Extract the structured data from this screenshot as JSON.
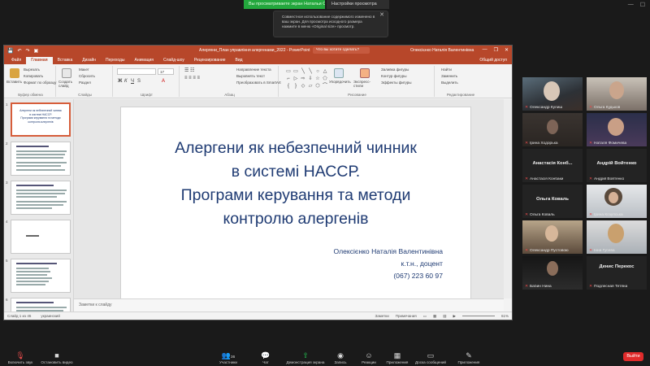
{
  "zoom": {
    "share_badge": "Вы просматриваете экран Натальи Олексиенко",
    "view_options": "Настройки просмотра",
    "toast_text": "Совместное использование содержимого изменено в ваш экран. Для просмотра исходного размера нажмите в меню «Original size» просмотр.",
    "toast_close": "✕",
    "toolbar": {
      "mute": "Включить звук",
      "video": "Остановить видео",
      "participants": "Участники",
      "participants_count": "36",
      "chat": "Чат",
      "share": "Демонстрация экрана",
      "record": "Запись",
      "reactions": "Реакции",
      "apps": "Приложения",
      "whiteboards": "Доска сообщений",
      "notes": "Приложения",
      "leave": "Выйти"
    },
    "participants": [
      {
        "name": "Олександр Кулиш",
        "kind": "video",
        "muted": true
      },
      {
        "name": "Ольга Кудьков",
        "kind": "video",
        "muted": true
      },
      {
        "name": "Ірина Ходорька",
        "kind": "video",
        "muted": true
      },
      {
        "name": "Наталя Фомичева",
        "kind": "video",
        "muted": true
      },
      {
        "name": "Анастасія Конбаки",
        "kind": "name",
        "display": "Анастасія Конб...",
        "muted": true
      },
      {
        "name": "Андрій Войтенко",
        "kind": "name",
        "display": "Андрій Войтенко",
        "muted": true
      },
      {
        "name": "Ольга Коваль",
        "kind": "name",
        "display": "Ольга Коваль",
        "muted": true
      },
      {
        "name": "Ірина Козупська",
        "kind": "video",
        "muted": true,
        "active": true
      },
      {
        "name": "Олександр Пустовою",
        "kind": "video",
        "muted": true
      },
      {
        "name": "Інна Гусева",
        "kind": "video",
        "muted": true
      },
      {
        "name": "Бабин Нина",
        "kind": "video",
        "muted": true
      },
      {
        "name": "Подлесная Тетяна",
        "kind": "name",
        "display": "Денис Перекос",
        "muted": true
      }
    ]
  },
  "ppt": {
    "doc_title": "Алергени_План управління алергенами_2022 - PowerPoint",
    "search_placeholder": "Что вы хотите сделать?",
    "user": "Олексієнко Наталія Валентинівна",
    "share_btn": "Общий доступ",
    "tabs": [
      "Файл",
      "Главная",
      "Вставка",
      "Дизайн",
      "Переходы",
      "Анимация",
      "Слайд-шоу",
      "Рецензирование",
      "Вид"
    ],
    "active_tab": "Главная",
    "ribbon": {
      "paste": "Вставить",
      "cut": "Вырезать",
      "copy": "Копировать",
      "format_painter": "Формат по образцу",
      "clipboard": "Буфер обмена",
      "new_slide": "Создать слайд",
      "layout": "Макет",
      "reset": "Сбросить",
      "section": "Раздел",
      "slides": "Слайды",
      "font": "Шрифт",
      "paragraph": "Абзац",
      "text_direction": "Направление текста",
      "align_text": "Выровнять текст",
      "smartart": "Преобразовать в SmartArt",
      "drawing": "Рисование",
      "arrange": "Упорядочить",
      "quick_styles": "Экспресс-стили",
      "fill": "Заливка фигуры",
      "outline": "Контур фигуры",
      "effects": "Эффекты фигуры",
      "find": "Найти",
      "replace": "Заменить",
      "select": "Выделить",
      "editing": "Редактирование",
      "font_size": "17"
    },
    "slide": {
      "title_lines": [
        "Алергени як небезпечний чинник",
        "в системі НАССР.",
        "Програми керування та методи",
        "контролю алергенів"
      ],
      "author": "Олексієнко Наталія Валентинівна",
      "degree": "к.т.н., доцент",
      "phone": "(067) 223 60 97"
    },
    "notes_placeholder": "Заметки к слайду",
    "status": {
      "slide_counter": "Слайд 1 из 45",
      "language": "украинский",
      "notes": "Заметки",
      "comments": "Примечания",
      "zoom": "61%"
    },
    "thumb_numbers": [
      "1",
      "2",
      "3",
      "4",
      "5",
      "6"
    ],
    "thumb1_text": [
      "Алергени як небезпечний чинник",
      "в системі НАССР.",
      "Програми керування та методи",
      "контролю алергенів"
    ]
  }
}
